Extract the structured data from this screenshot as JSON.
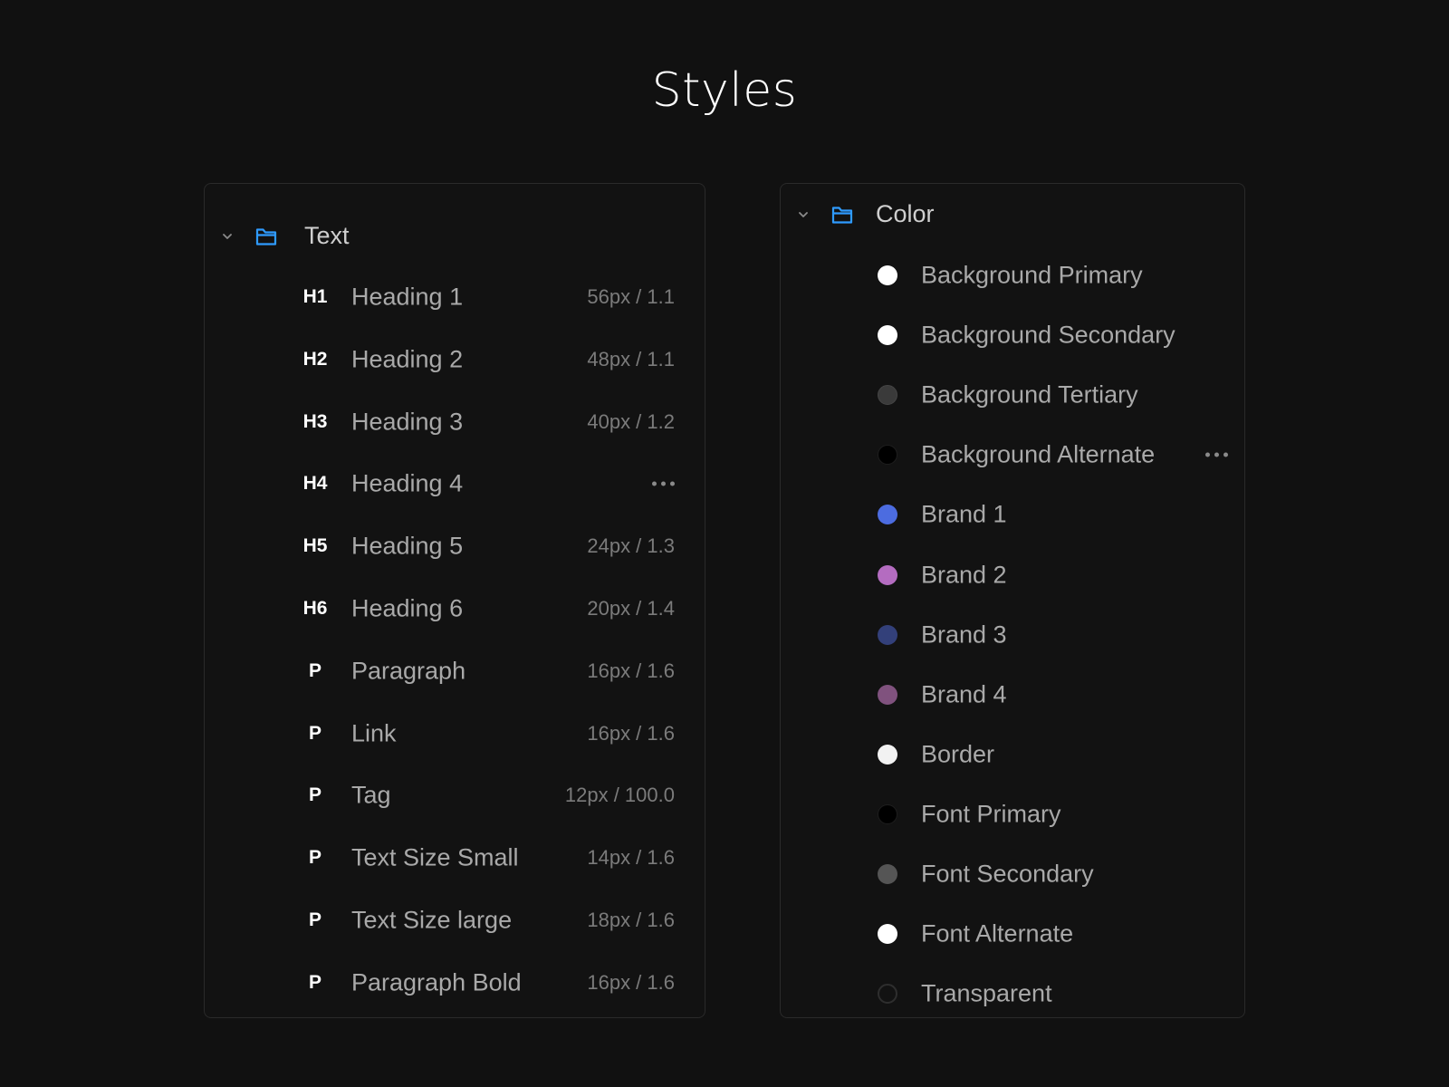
{
  "page": {
    "title": "Styles"
  },
  "text_group": {
    "label": "Text",
    "items": [
      {
        "tag": "H1",
        "name": "Heading 1",
        "meta": "56px / 1.1"
      },
      {
        "tag": "H2",
        "name": "Heading 2",
        "meta": "48px / 1.1"
      },
      {
        "tag": "H3",
        "name": "Heading 3",
        "meta": "40px / 1.2"
      },
      {
        "tag": "H4",
        "name": "Heading 4",
        "meta": ""
      },
      {
        "tag": "H5",
        "name": "Heading 5",
        "meta": "24px / 1.3"
      },
      {
        "tag": "H6",
        "name": "Heading 6",
        "meta": "20px / 1.4"
      },
      {
        "tag": "P",
        "name": "Paragraph",
        "meta": "16px / 1.6"
      },
      {
        "tag": "P",
        "name": "Link",
        "meta": "16px / 1.6"
      },
      {
        "tag": "P",
        "name": "Tag",
        "meta": "12px / 100.0"
      },
      {
        "tag": "P",
        "name": "Text Size Small",
        "meta": "14px / 1.6"
      },
      {
        "tag": "P",
        "name": "Text Size large",
        "meta": "18px / 1.6"
      },
      {
        "tag": "P",
        "name": "Paragraph Bold",
        "meta": "16px / 1.6"
      }
    ]
  },
  "color_group": {
    "label": "Color",
    "items": [
      {
        "name": "Background Primary",
        "color": "#ffffff"
      },
      {
        "name": "Background Secondary",
        "color": "#ffffff"
      },
      {
        "name": "Background Tertiary",
        "color": "#3a3a3a"
      },
      {
        "name": "Background Alternate",
        "color": "#000000"
      },
      {
        "name": "Brand 1",
        "color": "#4c6ce0"
      },
      {
        "name": "Brand 2",
        "color": "#b46cc0"
      },
      {
        "name": "Brand 3",
        "color": "#33407a"
      },
      {
        "name": "Brand 4",
        "color": "#80527e"
      },
      {
        "name": "Border",
        "color": "#f2f2f2"
      },
      {
        "name": "Font Primary",
        "color": "#000000"
      },
      {
        "name": "Font Secondary",
        "color": "#555555"
      },
      {
        "name": "Font Alternate",
        "color": "#ffffff"
      },
      {
        "name": "Transparent",
        "color": "transparent"
      }
    ]
  },
  "colors": {
    "folder_icon": "#2f9bff",
    "background": "#111111"
  }
}
